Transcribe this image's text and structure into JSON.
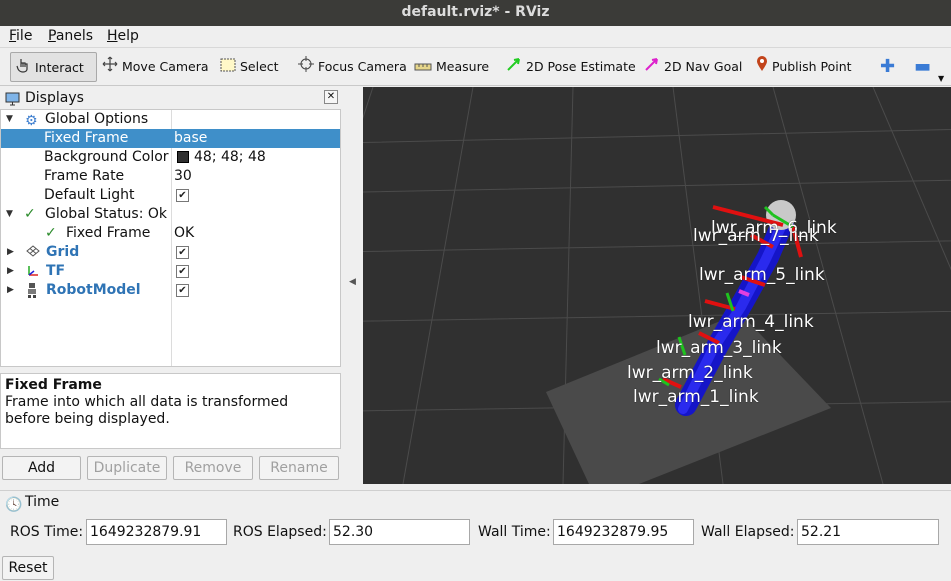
{
  "window": {
    "title": "default.rviz* - RViz"
  },
  "menu": [
    {
      "label": "File",
      "mnemonic": "F",
      "rest": "ile"
    },
    {
      "label": "Panels",
      "mnemonic": "P",
      "rest": "anels"
    },
    {
      "label": "Help",
      "mnemonic": "H",
      "rest": "elp"
    }
  ],
  "toolbar": {
    "interact": "Interact",
    "move_camera": "Move Camera",
    "select": "Select",
    "focus_camera": "Focus Camera",
    "measure": "Measure",
    "pose_estimate": "2D Pose Estimate",
    "nav_goal": "2D Nav Goal",
    "publish_point": "Publish Point",
    "pose_color": "#22cc22",
    "nav_color": "#dd22cc",
    "point_color": "#c2441b"
  },
  "displays": {
    "title": "Displays",
    "tree": {
      "global_options": "Global Options",
      "fixed_frame_label": "Fixed Frame",
      "fixed_frame_value": "base",
      "bg_color_label": "Background Color",
      "bg_color_value": "48; 48; 48",
      "bg_color_hex": "#303030",
      "frame_rate_label": "Frame Rate",
      "frame_rate_value": "30",
      "default_light_label": "Default Light",
      "global_status": "Global Status: Ok",
      "status_fixed_frame": "Fixed Frame",
      "status_fixed_frame_value": "OK",
      "grid": "Grid",
      "tf": "TF",
      "robot_model": "RobotModel"
    },
    "description": {
      "title": "Fixed Frame",
      "text": "Frame into which all data is transformed before being displayed."
    },
    "buttons": {
      "add": "Add",
      "duplicate": "Duplicate",
      "remove": "Remove",
      "rename": "Rename"
    }
  },
  "viewport": {
    "labels": [
      "lwr_arm_6_link",
      "lwr_arm_7_link",
      "lwr_arm_5_link",
      "lwr_arm_4_link",
      "lwr_arm_3_link",
      "lwr_arm_2_link",
      "lwr_arm_1_link"
    ]
  },
  "time": {
    "title": "Time",
    "ros_time_label": "ROS Time:",
    "ros_time": "1649232879.91",
    "ros_elapsed_label": "ROS Elapsed:",
    "ros_elapsed": "52.30",
    "wall_time_label": "Wall Time:",
    "wall_time": "1649232879.95",
    "wall_elapsed_label": "Wall Elapsed:",
    "wall_elapsed": "52.21",
    "reset": "Reset"
  }
}
